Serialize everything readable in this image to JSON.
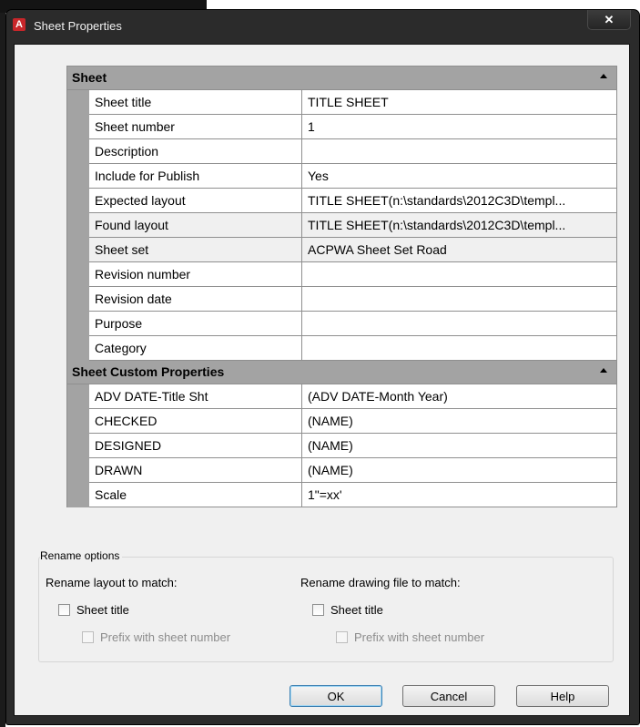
{
  "window": {
    "title": "Sheet Properties",
    "close_label": "✕"
  },
  "grid": {
    "sheet": {
      "label": "Sheet",
      "rows": [
        {
          "name": "Sheet title",
          "value": "TITLE SHEET"
        },
        {
          "name": "Sheet number",
          "value": "1"
        },
        {
          "name": "Description",
          "value": ""
        },
        {
          "name": "Include for Publish",
          "value": "Yes"
        },
        {
          "name": "Expected layout",
          "value": "TITLE SHEET(n:\\standards\\2012C3D\\templ..."
        },
        {
          "name": "Found layout",
          "value": "TITLE SHEET(n:\\standards\\2012C3D\\templ..."
        },
        {
          "name": "Sheet set",
          "value": "ACPWA Sheet Set Road"
        },
        {
          "name": "Revision number",
          "value": ""
        },
        {
          "name": "Revision date",
          "value": ""
        },
        {
          "name": "Purpose",
          "value": ""
        },
        {
          "name": "Category",
          "value": ""
        }
      ]
    },
    "custom": {
      "label": "Sheet Custom Properties",
      "rows": [
        {
          "name": "ADV DATE-Title Sht",
          "value": "(ADV DATE-Month Year)"
        },
        {
          "name": "CHECKED",
          "value": "(NAME)"
        },
        {
          "name": "DESIGNED",
          "value": "(NAME)"
        },
        {
          "name": "DRAWN",
          "value": "(NAME)"
        },
        {
          "name": "Scale",
          "value": "1\"=xx'"
        }
      ]
    }
  },
  "rename": {
    "group_label": "Rename options",
    "layout_label": "Rename layout to match:",
    "file_label": "Rename drawing file to match:",
    "layout_sheet_title": "Sheet title",
    "layout_prefix": "Prefix with sheet number",
    "file_sheet_title": "Sheet title",
    "file_prefix": "Prefix with sheet number"
  },
  "buttons": {
    "ok": "OK",
    "cancel": "Cancel",
    "help": "Help"
  }
}
